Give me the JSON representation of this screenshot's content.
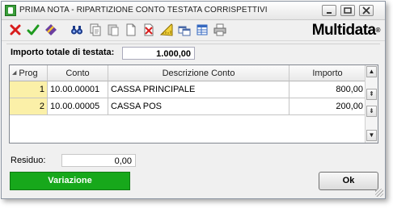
{
  "window": {
    "title": "PRIMA NOTA - RIPARTIZIONE CONTO TESTATA CORRISPETTIVI",
    "controls": [
      "minimize",
      "restore",
      "close"
    ]
  },
  "toolbar": {
    "icons": [
      "delete-icon",
      "confirm-check-icon",
      "edit-icon",
      "binoculars-search-icon",
      "copy-document-icon",
      "paste-icon",
      "new-document-icon",
      "cancel-document-icon",
      "ruler-icon",
      "windows-icon",
      "table-icon",
      "print-icon"
    ]
  },
  "logo": {
    "text": "Multidata",
    "reg": "®"
  },
  "header": {
    "importo_label": "Importo totale di testata:",
    "importo_value": "1.000,00"
  },
  "grid": {
    "columns": [
      "Prog",
      "Conto",
      "Descrizione Conto",
      "Importo"
    ],
    "rows": [
      {
        "prog": "1",
        "conto": "10.00.00001",
        "descrizione": "CASSA PRINCIPALE",
        "importo": "800,00"
      },
      {
        "prog": "2",
        "conto": "10.00.00005",
        "descrizione": "CASSA POS",
        "importo": "200,00"
      }
    ]
  },
  "footer": {
    "residuo_label": "Residuo:",
    "residuo_value": "0,00",
    "variazione_label": "Variazione",
    "ok_label": "Ok"
  },
  "colors": {
    "variazione_bg": "#17a81b",
    "prog_cell_bg": "#fbf0a8"
  }
}
